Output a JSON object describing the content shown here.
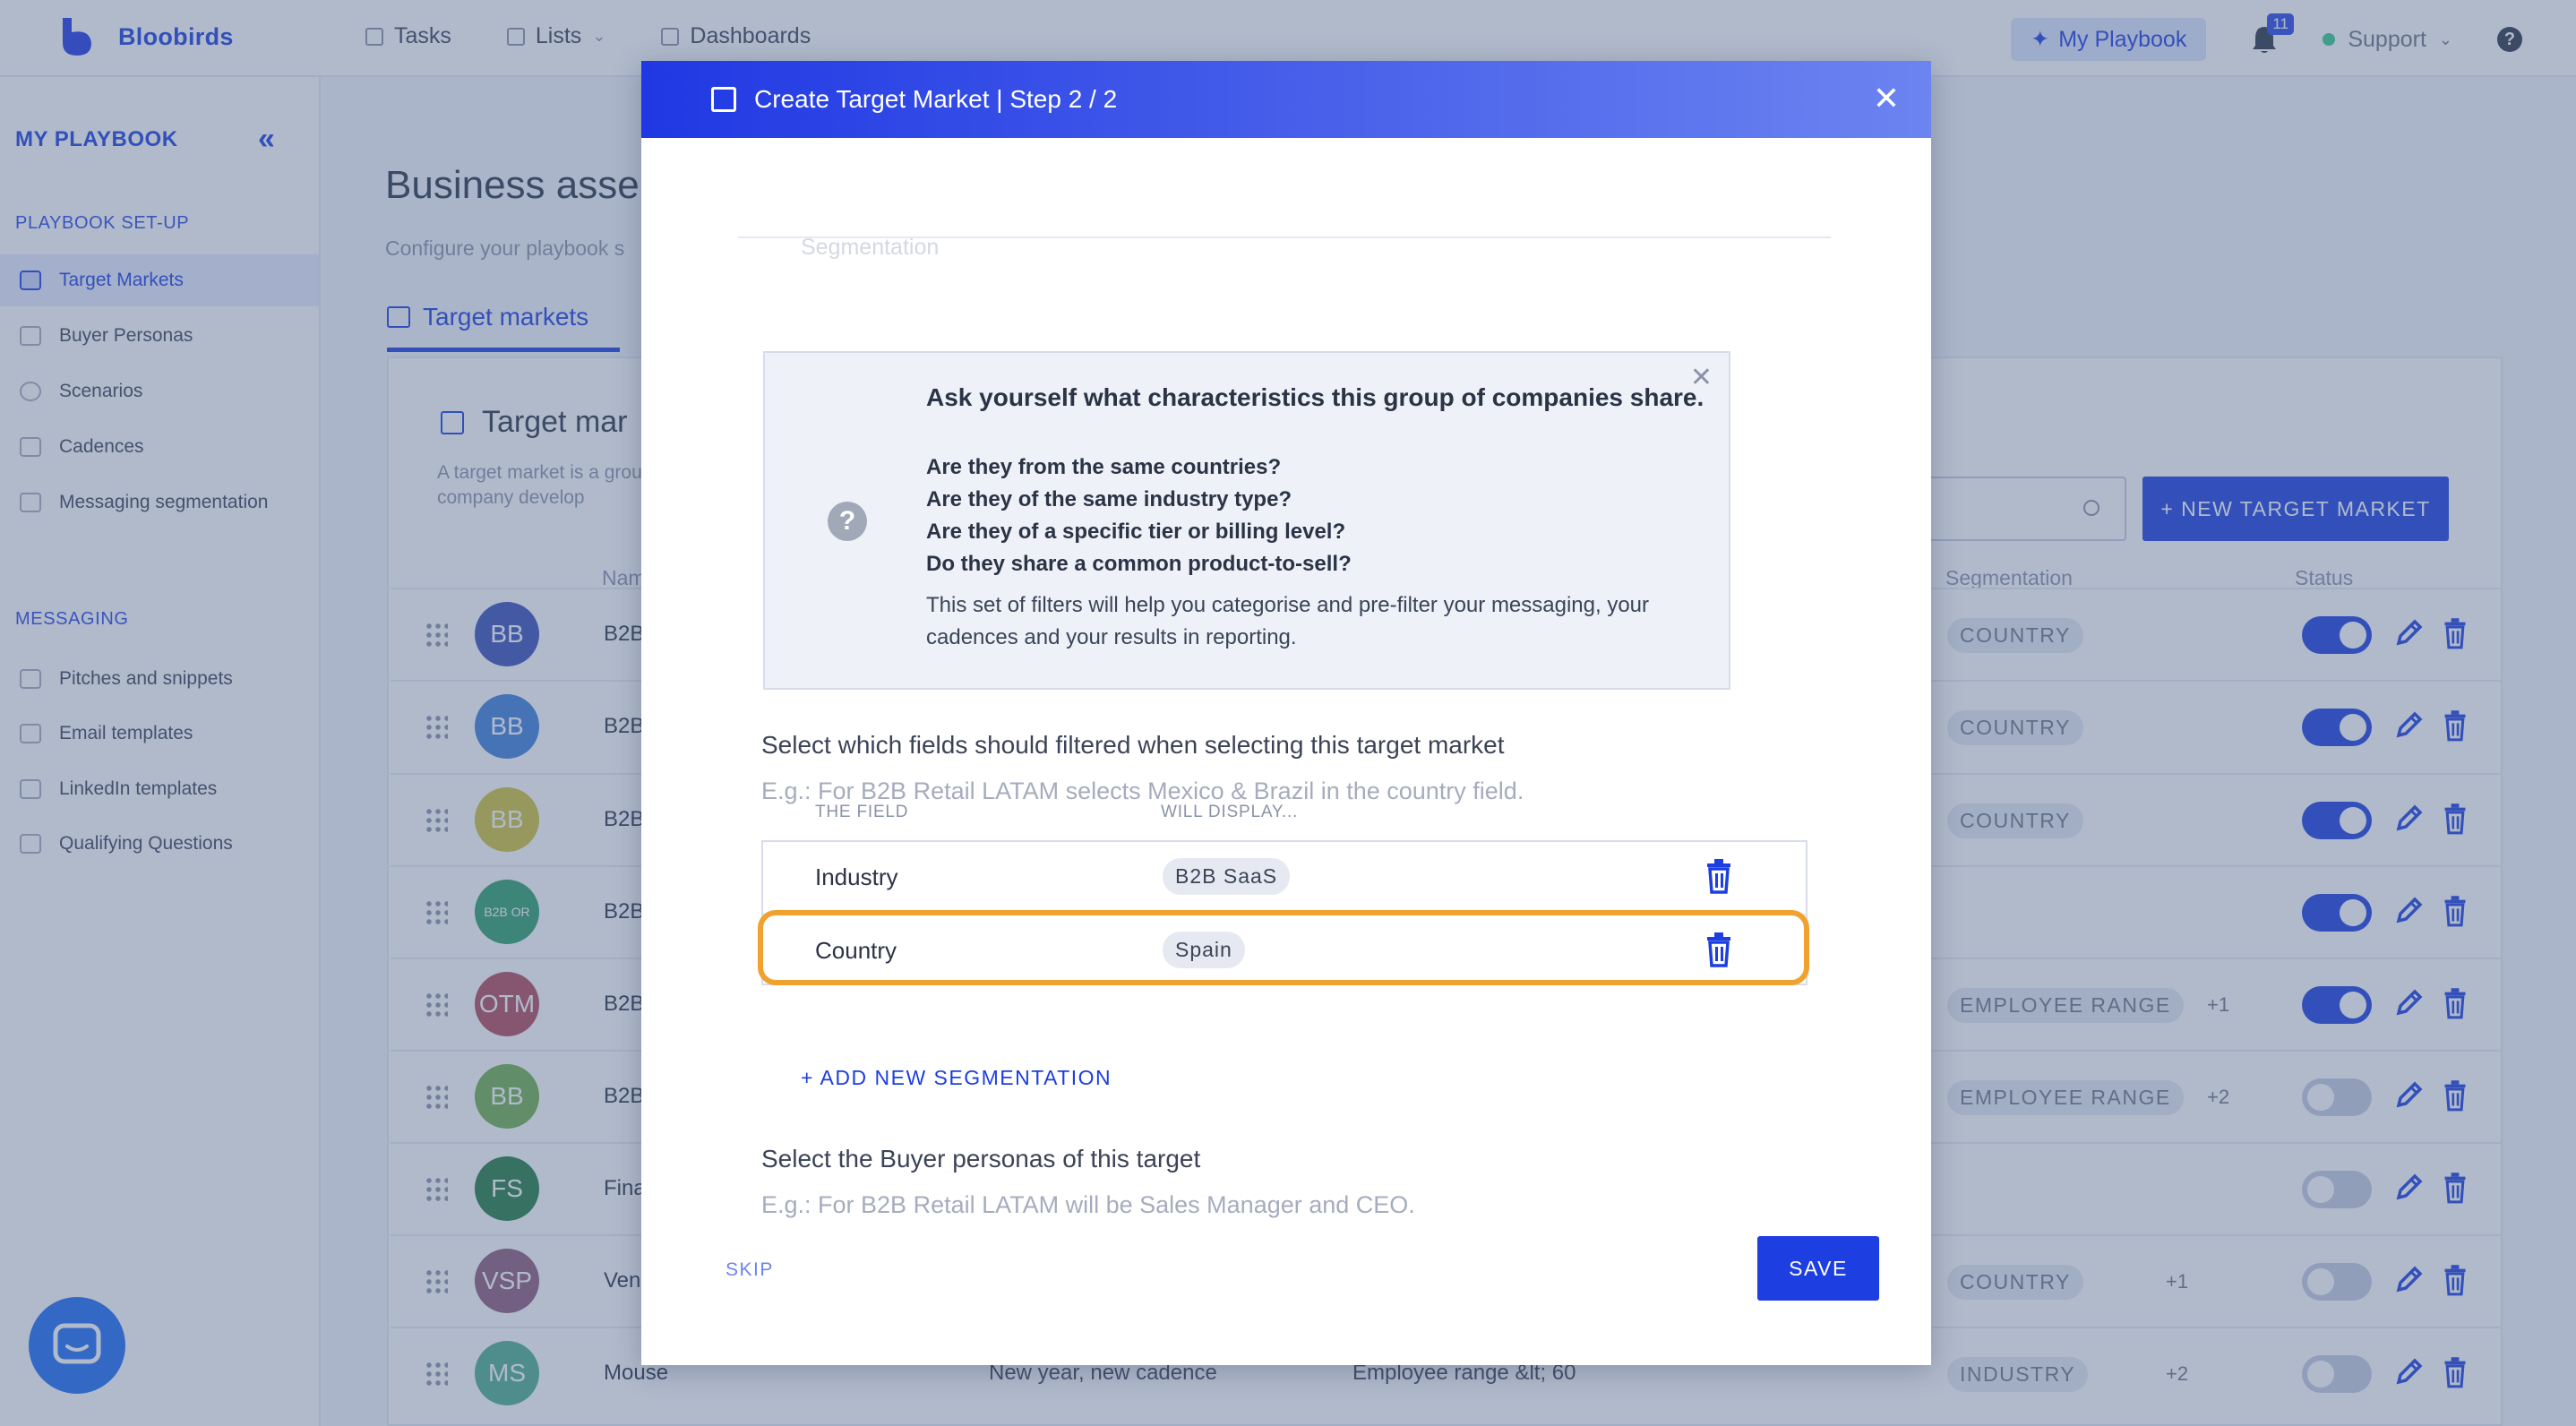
{
  "app": {
    "name": "Bloobirds"
  },
  "nav": {
    "tasks": "Tasks",
    "lists": "Lists",
    "dashboards": "Dashboards"
  },
  "topbar": {
    "playbook_label": "My Playbook",
    "notifications": "11",
    "support": "Support",
    "help": "?"
  },
  "sidebar": {
    "title": "MY PLAYBOOK",
    "setup_section": "PLAYBOOK SET-UP",
    "setup_items": [
      "Target Markets",
      "Buyer Personas",
      "Scenarios",
      "Cadences",
      "Messaging segmentation"
    ],
    "messaging_section": "MESSAGING",
    "messaging_items": [
      "Pitches and snippets",
      "Email templates",
      "LinkedIn templates",
      "Qualifying Questions"
    ]
  },
  "page": {
    "title": "Business asse",
    "subtitle": "Configure your playbook s",
    "tab": "Target markets",
    "panel_title": "Target mar",
    "panel_desc": "A target market is a grou your company develop",
    "new_button": "+ NEW TARGET MARKET",
    "col_name": "Nam",
    "col_segmentation": "Segmentation",
    "col_status": "Status"
  },
  "rows": [
    {
      "initials": "BB",
      "color": "#3a4fb8",
      "name": "B2B",
      "cadence": "",
      "criteria": "",
      "tag": "COUNTRY",
      "more": "",
      "on": true
    },
    {
      "initials": "BB",
      "color": "#3f7fd8",
      "name": "B2B",
      "cadence": "",
      "criteria": "",
      "tag": "COUNTRY",
      "more": "",
      "on": true
    },
    {
      "initials": "BB",
      "color": "#cfc23a",
      "name": "B2B",
      "cadence": "",
      "criteria": "",
      "tag": "COUNTRY",
      "more": "",
      "on": true
    },
    {
      "initials": "B2B OR",
      "color": "#2f9d6a",
      "name": "B2B",
      "cadence": "",
      "criteria": "",
      "tag": "",
      "more": "",
      "on": true
    },
    {
      "initials": "OTM",
      "color": "#b24a5a",
      "name": "B2B",
      "cadence": "",
      "criteria": "",
      "tag": "EMPLOYEE RANGE",
      "more": "+1",
      "on": true
    },
    {
      "initials": "BB",
      "color": "#6fae4c",
      "name": "B2B",
      "cadence": "",
      "criteria": "",
      "tag": "EMPLOYEE RANGE",
      "more": "+2",
      "on": false
    },
    {
      "initials": "FS",
      "color": "#247a3e",
      "name": "Fina",
      "cadence": "",
      "criteria": "",
      "tag": "",
      "more": "",
      "on": false
    },
    {
      "initials": "VSP",
      "color": "#8e5a78",
      "name": "Ven",
      "cadence": "",
      "criteria": "",
      "tag": "COUNTRY",
      "more": "+1",
      "on": false
    },
    {
      "initials": "MS",
      "color": "#4fae8c",
      "name": "Mouse",
      "cadence": "New year, new cadence",
      "criteria": "Employee range &lt; 60",
      "tag": "INDUSTRY",
      "more": "+2",
      "on": false
    }
  ],
  "modal": {
    "title": "Create Target Market | Step 2 / 2",
    "faded_label": "Segmentation",
    "info": {
      "title": "Ask yourself what characteristics this group of companies share.",
      "questions": [
        "Are they from the same countries?",
        "Are they of the same industry type?",
        "Are they of a specific tier or billing level?",
        "Do they share a common product-to-sell?"
      ],
      "footer": "This set of filters will help you categorise and pre-filter your messaging, your cadences and your results in reporting."
    },
    "fields_title": "Select which fields should filtered when selecting this target market",
    "fields_hint": "E.g.: For B2B Retail LATAM selects Mexico & Brazil in the country field.",
    "col_field": "THE FIELD",
    "col_display": "WILL DISPLAY...",
    "segmentations": [
      {
        "field": "Industry",
        "value": "B2B SaaS"
      },
      {
        "field": "Country",
        "value": "Spain"
      }
    ],
    "add_label": "+ ADD NEW SEGMENTATION",
    "personas_title": "Select the Buyer personas of this target",
    "personas_hint": "E.g.: For B2B Retail LATAM will be Sales Manager and CEO.",
    "skip": "SKIP",
    "save": "SAVE"
  }
}
